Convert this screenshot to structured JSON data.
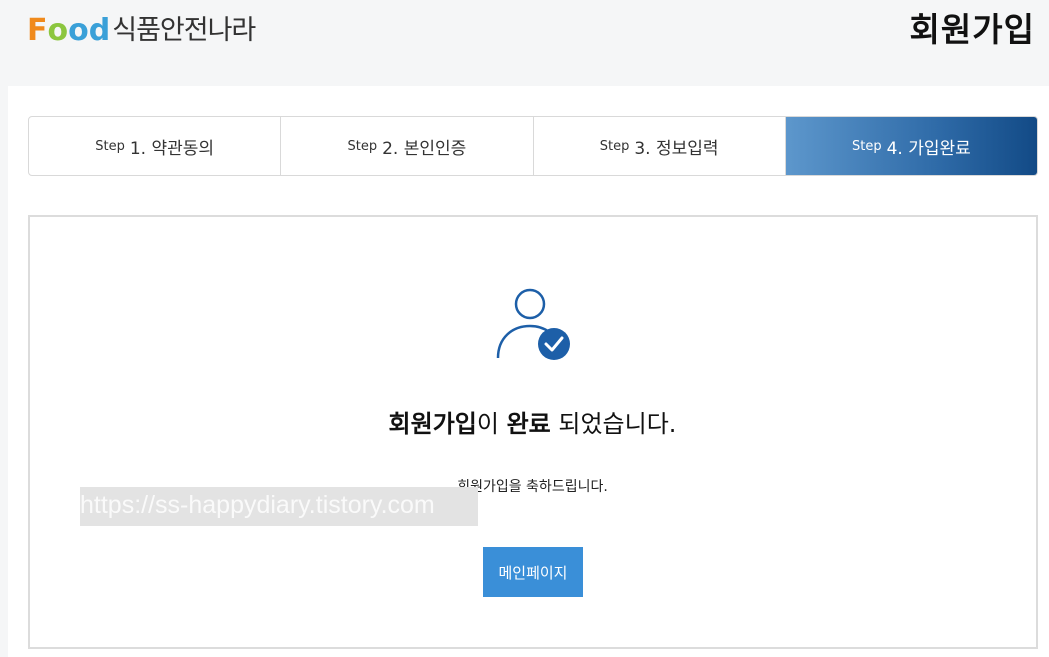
{
  "header": {
    "logo_letters": {
      "f": "F",
      "o1": "o",
      "o2": "o",
      "d": "d"
    },
    "logo_korean": "식품안전나라",
    "page_title": "회원가입"
  },
  "steps": [
    {
      "prefix": "Step",
      "label": "1. 약관동의",
      "active": false
    },
    {
      "prefix": "Step",
      "label": "2. 본인인증",
      "active": false
    },
    {
      "prefix": "Step",
      "label": "3. 정보입력",
      "active": false
    },
    {
      "prefix": "Step",
      "label": "4. 가입완료",
      "active": true
    }
  ],
  "result": {
    "title_part1": "회원가입",
    "title_part2": "이 ",
    "title_part3": "완료",
    "title_part4": " 되었습니다.",
    "subtitle": "회원가입을 축하드립니다.",
    "main_button": "메인페이지"
  },
  "watermark": "https://ss-happydiary.tistory.com",
  "colors": {
    "accent": "#3a8fd8",
    "step_active_start": "#5d97cc",
    "step_active_end": "#124a86",
    "icon_blue": "#1d5fa8",
    "logo_orange": "#f08a1c",
    "logo_green": "#8cc63f",
    "logo_blue": "#3aa0d8"
  },
  "icons": {
    "user_complete": "user-check-icon"
  }
}
